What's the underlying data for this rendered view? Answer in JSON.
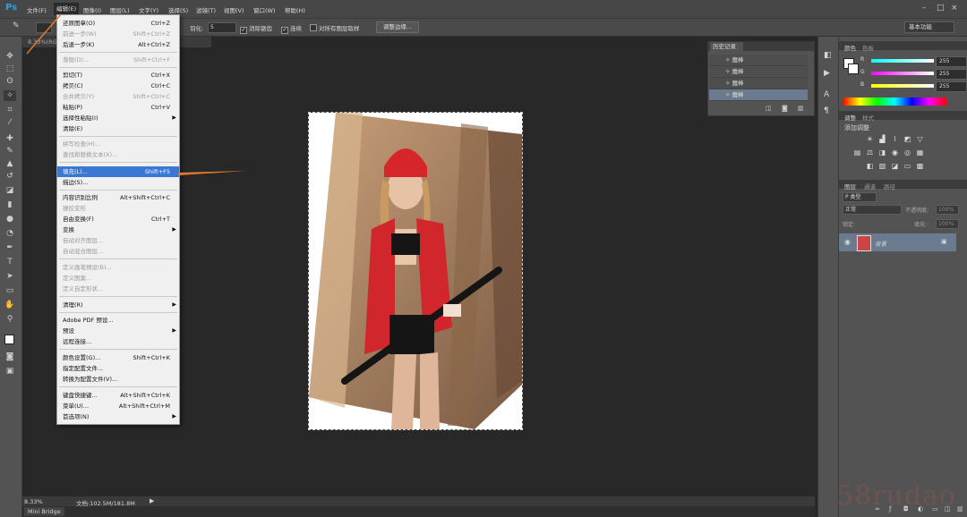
{
  "app": {
    "logo": "Ps"
  },
  "menubar": {
    "items": [
      "文件(F)",
      "编辑(E)",
      "图像(I)",
      "图层(L)",
      "文字(Y)",
      "选择(S)",
      "滤镜(T)",
      "视图(V)",
      "窗口(W)",
      "帮助(H)"
    ],
    "window_controls": [
      "–",
      "□",
      "×"
    ]
  },
  "options_bar": {
    "feather_label": "羽化:",
    "feather_value": "5",
    "antialias_label": "消除锯齿",
    "contiguous_label": "连续",
    "sample_all_label": "对所有图层取样",
    "refine_edge_button": "调整边缘...",
    "workspace": "基本功能"
  },
  "document": {
    "tab": "8.33%(RGB/8) *",
    "zoom": "8.33%",
    "doc_size": "文档:102.5M/181.8M",
    "mini_bridge_tab": "Mini Bridge"
  },
  "edit_menu": {
    "items": [
      {
        "label": "还原图章(O)",
        "shortcut": "Ctrl+Z",
        "disabled": false
      },
      {
        "label": "前进一步(W)",
        "shortcut": "Shift+Ctrl+Z",
        "disabled": true
      },
      {
        "label": "后退一步(K)",
        "shortcut": "Alt+Ctrl+Z",
        "disabled": false
      },
      {
        "label": "渐隐(D)...",
        "shortcut": "Shift+Ctrl+F",
        "disabled": true
      },
      {
        "label": "剪切(T)",
        "shortcut": "Ctrl+X",
        "disabled": false
      },
      {
        "label": "拷贝(C)",
        "shortcut": "Ctrl+C",
        "disabled": false
      },
      {
        "label": "合并拷贝(Y)",
        "shortcut": "Shift+Ctrl+C",
        "disabled": true
      },
      {
        "label": "粘贴(P)",
        "shortcut": "Ctrl+V",
        "disabled": false
      },
      {
        "label": "选择性粘贴(I)",
        "shortcut": "",
        "disabled": false
      },
      {
        "label": "清除(E)",
        "shortcut": "",
        "disabled": false
      },
      {
        "label": "拼写检查(H)...",
        "shortcut": "",
        "disabled": true
      },
      {
        "label": "查找和替换文本(X)...",
        "shortcut": "",
        "disabled": true
      },
      {
        "label": "填充(L)...",
        "shortcut": "Shift+F5",
        "disabled": false
      },
      {
        "label": "描边(S)...",
        "shortcut": "",
        "disabled": false
      },
      {
        "label": "内容识别比例",
        "shortcut": "Alt+Shift+Ctrl+C",
        "disabled": false
      },
      {
        "label": "操控变形",
        "shortcut": "",
        "disabled": true
      },
      {
        "label": "自由变换(F)",
        "shortcut": "Ctrl+T",
        "disabled": false
      },
      {
        "label": "变换",
        "shortcut": "",
        "disabled": false
      },
      {
        "label": "自动对齐图层...",
        "shortcut": "",
        "disabled": true
      },
      {
        "label": "自动混合图层...",
        "shortcut": "",
        "disabled": true
      },
      {
        "label": "定义画笔预设(B)...",
        "shortcut": "",
        "disabled": true
      },
      {
        "label": "定义图案...",
        "shortcut": "",
        "disabled": true
      },
      {
        "label": "定义自定形状...",
        "shortcut": "",
        "disabled": true
      },
      {
        "label": "清理(R)",
        "shortcut": "",
        "disabled": false
      },
      {
        "label": "Adobe PDF 预设...",
        "shortcut": "",
        "disabled": false
      },
      {
        "label": "预设",
        "shortcut": "",
        "disabled": false
      },
      {
        "label": "远程连接...",
        "shortcut": "",
        "disabled": false
      },
      {
        "label": "颜色设置(G)...",
        "shortcut": "Shift+Ctrl+K",
        "disabled": false
      },
      {
        "label": "指定配置文件...",
        "shortcut": "",
        "disabled": false
      },
      {
        "label": "转换为配置文件(V)...",
        "shortcut": "",
        "disabled": false
      },
      {
        "label": "键盘快捷键...",
        "shortcut": "Alt+Shift+Ctrl+K",
        "disabled": false
      },
      {
        "label": "菜单(U)...",
        "shortcut": "Alt+Shift+Ctrl+M",
        "disabled": false
      },
      {
        "label": "首选项(N)",
        "shortcut": "",
        "disabled": false
      }
    ]
  },
  "history_panel": {
    "tab": "历史记录",
    "items": [
      "魔棒",
      "魔棒",
      "魔棒",
      "魔棒"
    ]
  },
  "color_panel": {
    "tabs": [
      "颜色",
      "色板"
    ],
    "r_label": "R",
    "g_label": "G",
    "b_label": "B",
    "r": "255",
    "g": "255",
    "b": "255"
  },
  "adjustments_panel": {
    "tabs": [
      "调整",
      "样式"
    ],
    "title": "添加调整"
  },
  "layers_panel": {
    "tabs": [
      "图层",
      "通道",
      "路径"
    ],
    "kind_label": "P 类型",
    "blend_mode": "正常",
    "opacity_label": "不透明度:",
    "opacity": "100%",
    "lock_label": "锁定:",
    "fill_label": "填充:",
    "fill": "100%",
    "layer_name": "背景"
  },
  "watermark": "58rudao",
  "colors": {
    "accent_highlight": "#3a78d4",
    "annotation_arrow": "#e07a2e"
  }
}
